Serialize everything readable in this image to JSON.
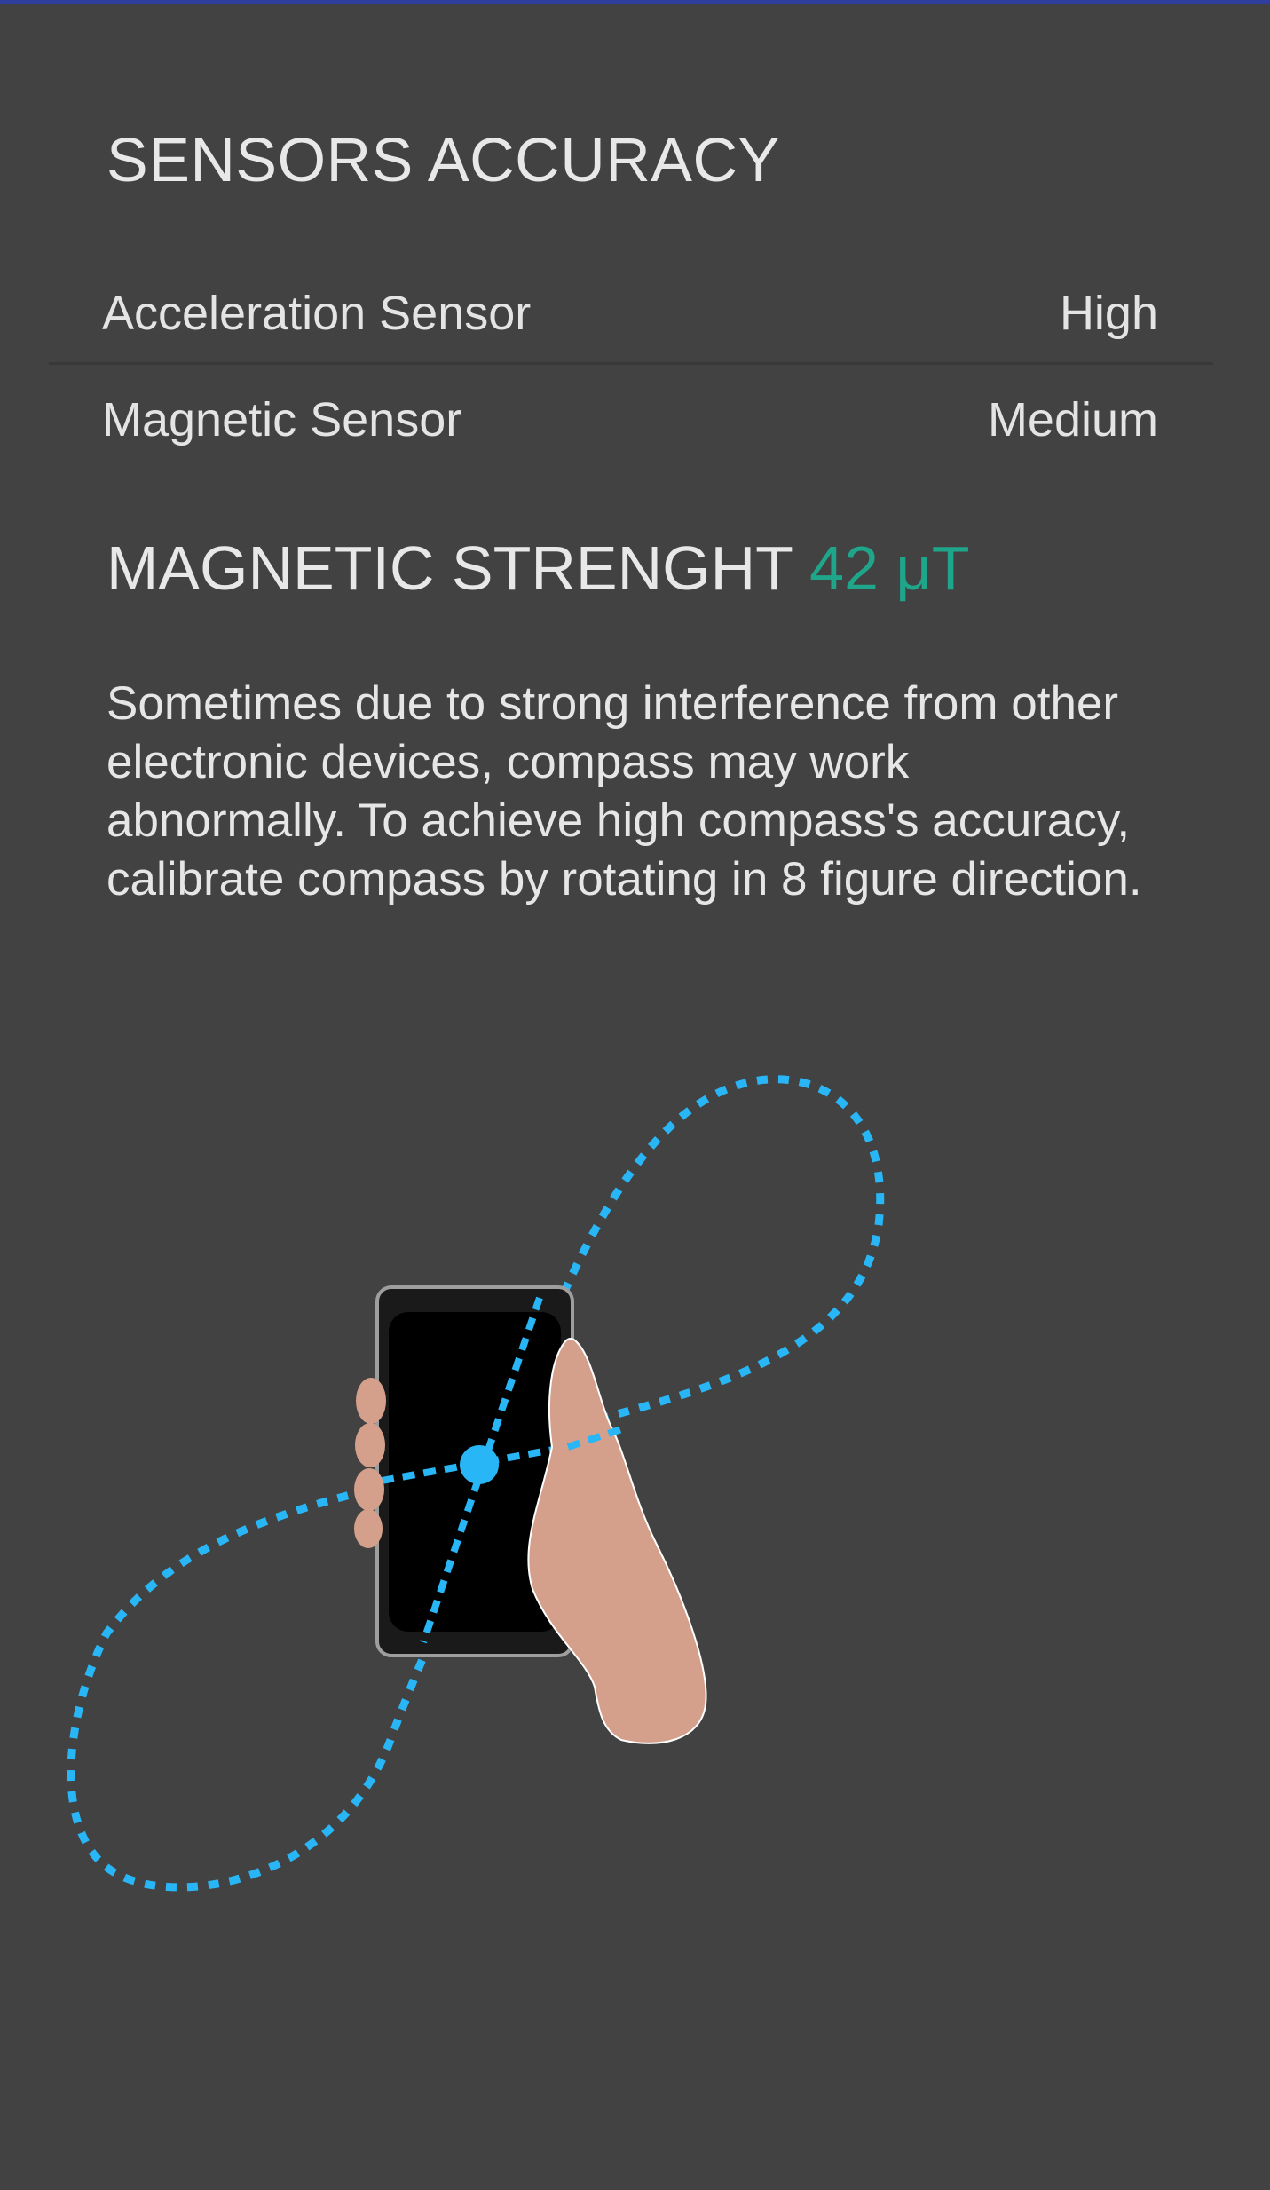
{
  "sensors_accuracy": {
    "title": "SENSORS ACCURACY",
    "rows": [
      {
        "label": "Acceleration Sensor",
        "value": "High"
      },
      {
        "label": "Magnetic Sensor",
        "value": "Medium"
      }
    ]
  },
  "magnetic": {
    "title": "MAGNETIC STRENGHT",
    "value": "42 μT"
  },
  "calibration": {
    "text": "Sometimes due to strong interference from other electronic devices, compass may work abnormally. To achieve high compass's accuracy, calibrate compass by rotating in 8 figure direction."
  },
  "illustration": {
    "icon": "figure-eight-calibration-icon"
  },
  "colors": {
    "background": "#424242",
    "accent": "#1fa58a",
    "path": "#29b6f6",
    "skin": "#d4a08b",
    "top_bar": "#303f9f"
  }
}
